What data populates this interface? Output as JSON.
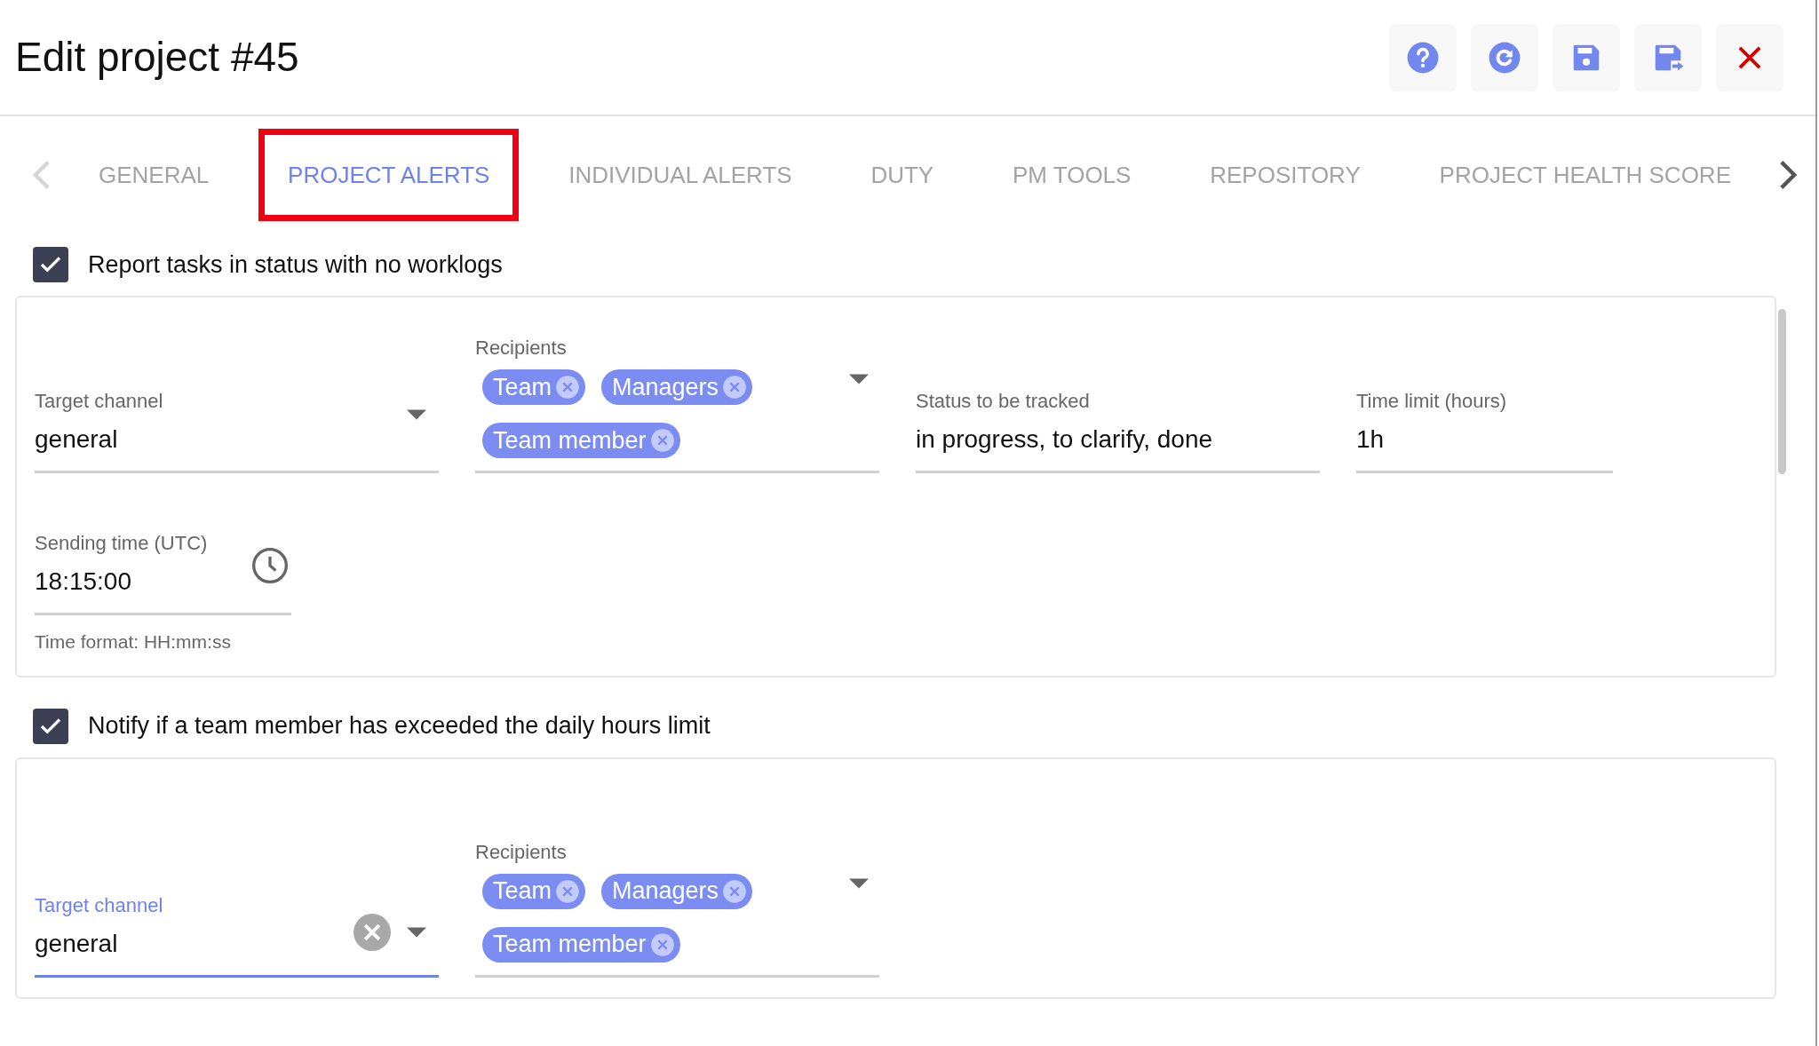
{
  "header": {
    "title": "Edit project #45",
    "actions": [
      {
        "kind": "help"
      },
      {
        "kind": "refresh"
      },
      {
        "kind": "save"
      },
      {
        "kind": "save_and_exit"
      },
      {
        "kind": "close"
      }
    ]
  },
  "tabs": [
    {
      "label": "GENERAL",
      "selected": false,
      "highlighted": false
    },
    {
      "label": "PROJECT ALERTS",
      "selected": true,
      "highlighted": true
    },
    {
      "label": "INDIVIDUAL ALERTS",
      "selected": false,
      "highlighted": false
    },
    {
      "label": "DUTY",
      "selected": false,
      "highlighted": false
    },
    {
      "label": "PM TOOLS",
      "selected": false,
      "highlighted": false
    },
    {
      "label": "REPOSITORY",
      "selected": false,
      "highlighted": false
    },
    {
      "label": "PROJECT HEALTH SCORE",
      "selected": false,
      "highlighted": false
    }
  ],
  "alerts": [
    {
      "label": "Report tasks in status with no worklogs",
      "checked": true,
      "fields": [
        {
          "kind": "select",
          "label": "Target channel",
          "value": "general",
          "focused": false,
          "clearable": false
        },
        {
          "kind": "chips",
          "label": "Recipients",
          "chips": [
            "Team",
            "Managers",
            "Team member"
          ]
        },
        {
          "kind": "text",
          "label": "Status to be tracked",
          "value": "in progress, to clarify, done"
        },
        {
          "kind": "text_short",
          "label": "Time limit (hours)",
          "value": "1h"
        },
        {
          "kind": "time",
          "label": "Sending time (UTC)",
          "value": "18:15:00",
          "helper": "Time format: HH:mm:ss"
        }
      ]
    },
    {
      "label": "Notify if a team member has exceeded the daily hours limit",
      "checked": true,
      "fields": [
        {
          "kind": "select",
          "label": "Target channel",
          "value": "general",
          "focused": true,
          "clearable": true
        },
        {
          "kind": "chips",
          "label": "Recipients",
          "chips": [
            "Team",
            "Managers",
            "Team member"
          ]
        }
      ]
    }
  ]
}
